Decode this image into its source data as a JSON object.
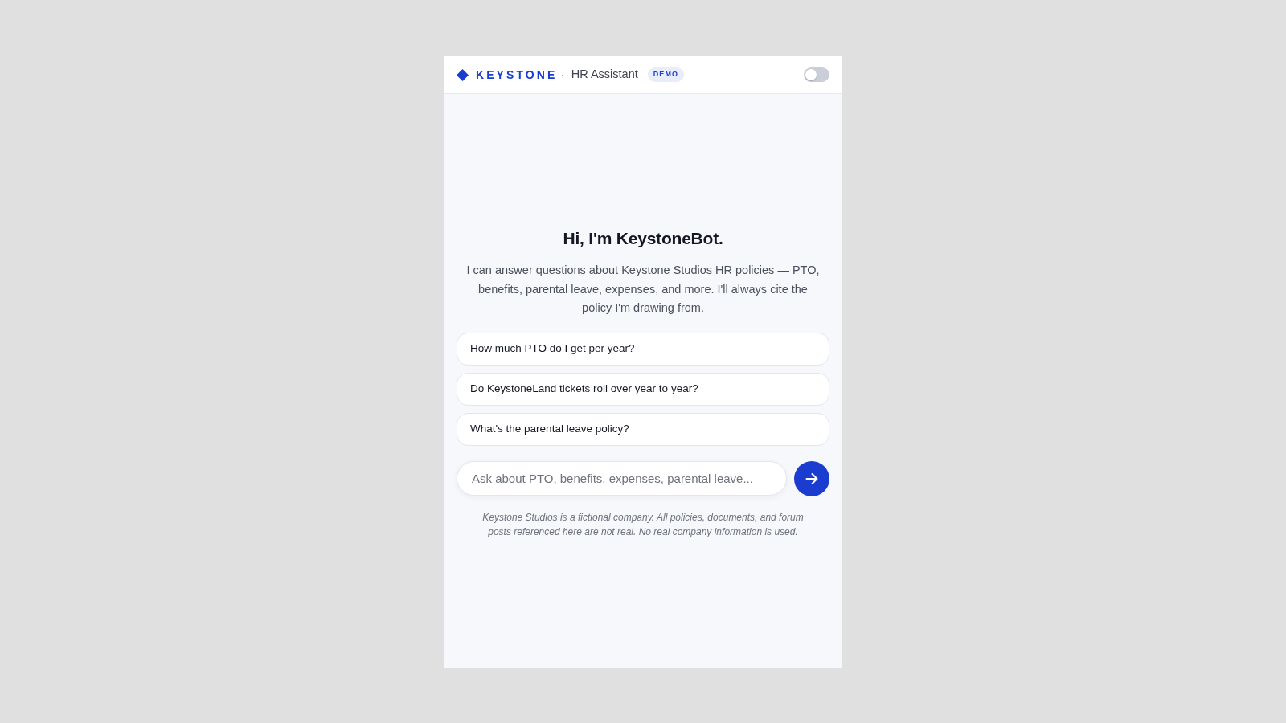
{
  "header": {
    "brand": "KEYSTONE",
    "separator": "·",
    "subtitle": "HR Assistant",
    "badge": "DEMO",
    "toggle": {
      "on": false
    }
  },
  "welcome": {
    "title": "Hi, I'm KeystoneBot.",
    "description": "I can answer questions about Keystone Studios HR policies — PTO, benefits, parental leave, expenses, and more. I'll always cite the policy I'm drawing from."
  },
  "suggestions": [
    {
      "label": "How much PTO do I get per year?"
    },
    {
      "label": "Do KeystoneLand tickets roll over year to year?"
    },
    {
      "label": "What's the parental leave policy?"
    }
  ],
  "composer": {
    "placeholder": "Ask about PTO, benefits, expenses, parental leave..."
  },
  "disclaimer": "Keystone Studios is a fictional company. All policies, documents, and forum posts referenced here are not real. No real company information is used."
}
